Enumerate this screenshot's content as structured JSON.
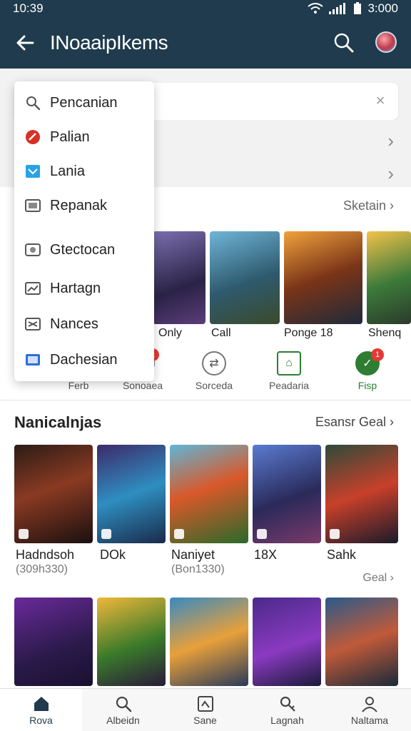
{
  "status": {
    "time": "10:39",
    "battery_text": "3:000"
  },
  "appbar": {
    "title": "INoaaipIkems"
  },
  "section1": {
    "see_all": "Sketain"
  },
  "games_row": {
    "labels": [
      "Only",
      "Call",
      "Ponge 18",
      "Shenq"
    ]
  },
  "categories": [
    {
      "label": "Ferb"
    },
    {
      "label": "Sonoaea"
    },
    {
      "label": "Sorceda"
    },
    {
      "label": "Peadaria"
    },
    {
      "label": "Fisp"
    }
  ],
  "section2": {
    "title": "Nanicalnjas",
    "more": "Esansr Geal",
    "cards": [
      {
        "title": "Hadndsoh",
        "sub": "(309h330)"
      },
      {
        "title": "DOk",
        "sub": ""
      },
      {
        "title": "Naniyet",
        "sub": "(Bon1330)"
      },
      {
        "title": "18X",
        "sub": ""
      },
      {
        "title": "Sahk",
        "sub": ""
      }
    ],
    "row_more": "Geal"
  },
  "dropdown": {
    "items": [
      {
        "label": "Pencanian",
        "icon": "search-icon"
      },
      {
        "label": "Palian",
        "icon": "red-badge-icon"
      },
      {
        "label": "Lania",
        "icon": "blue-mail-icon"
      },
      {
        "label": "Repanak",
        "icon": "box-icon"
      },
      {
        "label": "Gtectocan",
        "icon": "camera-icon"
      },
      {
        "label": "Hartagn",
        "icon": "chart-icon"
      },
      {
        "label": "Nances",
        "icon": "tag-icon"
      },
      {
        "label": "Dachesian",
        "icon": "screen-icon"
      }
    ]
  },
  "bottomnav": {
    "items": [
      {
        "label": "Rova",
        "icon": "home-icon"
      },
      {
        "label": "Albeidn",
        "icon": "search-icon"
      },
      {
        "label": "Sane",
        "icon": "grid-icon"
      },
      {
        "label": "Lagnah",
        "icon": "key-icon"
      },
      {
        "label": "Naltama",
        "icon": "profile-icon"
      }
    ]
  },
  "colors": {
    "appbar": "#1f3b4d",
    "accent_green": "#2e7d32",
    "badge_red": "#e53935"
  }
}
